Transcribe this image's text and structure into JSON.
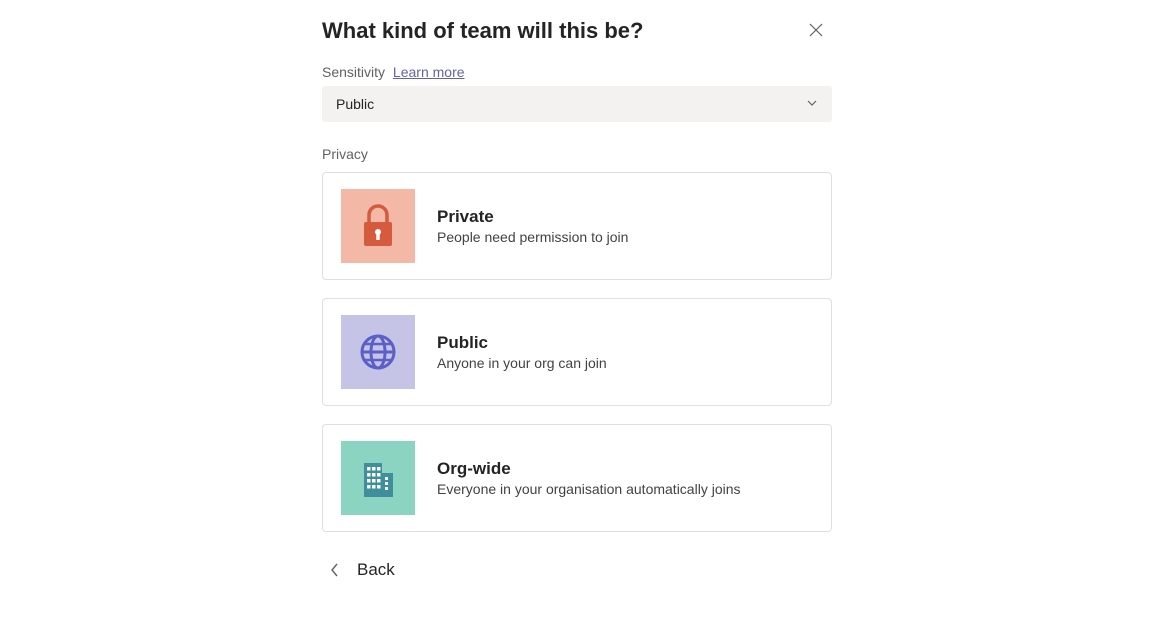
{
  "dialog": {
    "title": "What kind of team will this be?",
    "sensitivity_label": "Sensitivity",
    "learn_more": "Learn more",
    "privacy_label": "Privacy",
    "back_label": "Back"
  },
  "dropdown": {
    "selected": "Public"
  },
  "options": [
    {
      "key": "private",
      "title": "Private",
      "desc": "People need permission to join",
      "icon": "lock-icon",
      "bg": "#F4B9A6",
      "fg": "#D65A3E"
    },
    {
      "key": "public",
      "title": "Public",
      "desc": "Anyone in your org can join",
      "icon": "globe-icon",
      "bg": "#C5C3E6",
      "fg": "#5B5FC7"
    },
    {
      "key": "orgwide",
      "title": "Org-wide",
      "desc": "Everyone in your organisation automatically joins",
      "icon": "building-icon",
      "bg": "#8CD4C2",
      "fg": "#3E8F9B"
    }
  ]
}
